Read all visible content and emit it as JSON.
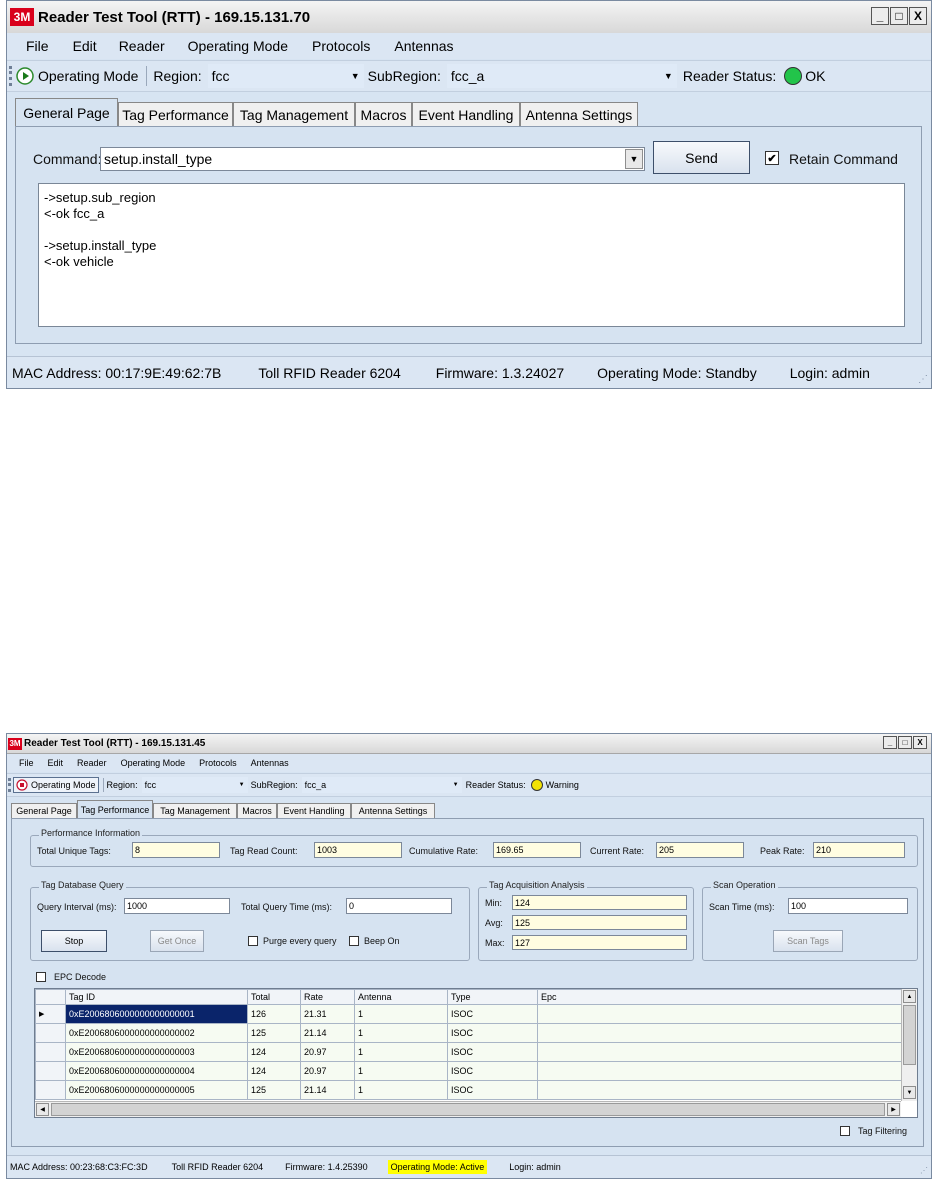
{
  "window1": {
    "logo": "3M",
    "title": "Reader Test Tool (RTT) - 169.15.131.70",
    "controls": [
      "_",
      "□",
      "X"
    ],
    "menu": [
      "File",
      "Edit",
      "Reader",
      "Operating Mode",
      "Protocols",
      "Antennas"
    ],
    "toolbar": {
      "mode_label": "Operating Mode",
      "region_label": "Region:",
      "region_value": "fcc",
      "subregion_label": "SubRegion:",
      "subregion_value": "fcc_a",
      "status_label": "Reader Status:",
      "status_value": "OK",
      "status_color": "#22c44a",
      "mode_icon": "play-icon"
    },
    "tabs": [
      "General Page",
      "Tag Performance",
      "Tag Management",
      "Macros",
      "Event Handling",
      "Antenna Settings"
    ],
    "active_tab": "General Page",
    "command_label": "Command:",
    "command_value": "setup.install_type",
    "send_label": "Send",
    "retain_label": "Retain Command",
    "retain_checked": "✔",
    "output_lines": [
      "->setup.sub_region",
      "<-ok fcc_a",
      "",
      "->setup.install_type",
      "<-ok vehicle"
    ],
    "status": {
      "mac": "MAC Address: 00:17:9E:49:62:7B",
      "reader": "Toll RFID Reader 6204",
      "firmware": "Firmware: 1.3.24027",
      "mode": "Operating Mode: Standby",
      "login": "Login: admin"
    }
  },
  "window2": {
    "logo": "3M",
    "title": "Reader Test Tool (RTT) - 169.15.131.45",
    "controls": [
      "_",
      "□",
      "X"
    ],
    "menu": [
      "File",
      "Edit",
      "Reader",
      "Operating Mode",
      "Protocols",
      "Antennas"
    ],
    "toolbar": {
      "mode_label": "Operating Mode",
      "region_label": "Region:",
      "region_value": "fcc",
      "subregion_label": "SubRegion:",
      "subregion_value": "fcc_a",
      "status_label": "Reader Status:",
      "status_value": "Warning",
      "status_color": "#f2e205",
      "mode_icon": "stop-icon"
    },
    "tabs": [
      "General Page",
      "Tag Performance",
      "Tag Management",
      "Macros",
      "Event Handling",
      "Antenna Settings"
    ],
    "active_tab": "Tag Performance",
    "performance": {
      "legend": "Performance Information",
      "unique_label": "Total Unique Tags:",
      "unique_value": "8",
      "readcount_label": "Tag Read Count:",
      "readcount_value": "1003",
      "cumrate_label": "Cumulative Rate:",
      "cumrate_value": "169.65",
      "currate_label": "Current Rate:",
      "currate_value": "205",
      "peak_label": "Peak Rate:",
      "peak_value": "210"
    },
    "query": {
      "legend": "Tag Database Query",
      "interval_label": "Query Interval (ms):",
      "interval_value": "1000",
      "total_label": "Total Query Time (ms):",
      "total_value": "0",
      "stop_label": "Stop",
      "getonce_label": "Get Once",
      "purge_label": "Purge every query",
      "beep_label": "Beep On"
    },
    "acq": {
      "legend": "Tag Acquisition Analysis",
      "min_label": "Min:",
      "min_value": "124",
      "avg_label": "Avg:",
      "avg_value": "125",
      "max_label": "Max:",
      "max_value": "127"
    },
    "scan": {
      "legend": "Scan Operation",
      "time_label": "Scan Time (ms):",
      "time_value": "100",
      "button_label": "Scan Tags"
    },
    "epc_decode_label": "EPC Decode",
    "grid": {
      "columns": [
        "Tag ID",
        "Total",
        "Rate",
        "Antenna",
        "Type",
        "Epc"
      ],
      "rows": [
        {
          "id": "0xE2006806000000000000001",
          "total": "126",
          "rate": "21.31",
          "antenna": "1",
          "type": "ISOC",
          "epc": ""
        },
        {
          "id": "0xE2006806000000000000002",
          "total": "125",
          "rate": "21.14",
          "antenna": "1",
          "type": "ISOC",
          "epc": ""
        },
        {
          "id": "0xE2006806000000000000003",
          "total": "124",
          "rate": "20.97",
          "antenna": "1",
          "type": "ISOC",
          "epc": ""
        },
        {
          "id": "0xE2006806000000000000004",
          "total": "124",
          "rate": "20.97",
          "antenna": "1",
          "type": "ISOC",
          "epc": ""
        },
        {
          "id": "0xE2006806000000000000005",
          "total": "125",
          "rate": "21.14",
          "antenna": "1",
          "type": "ISOC",
          "epc": ""
        }
      ],
      "row_marker": "▶"
    },
    "tag_filtering_label": "Tag Filtering",
    "status": {
      "mac": "MAC Address: 00:23:68:C3:FC:3D",
      "reader": "Toll RFID Reader 6204",
      "firmware": "Firmware: 1.4.25390",
      "mode": "Operating Mode: Active",
      "mode_highlight": "#ffff00",
      "login": "Login: admin"
    }
  }
}
